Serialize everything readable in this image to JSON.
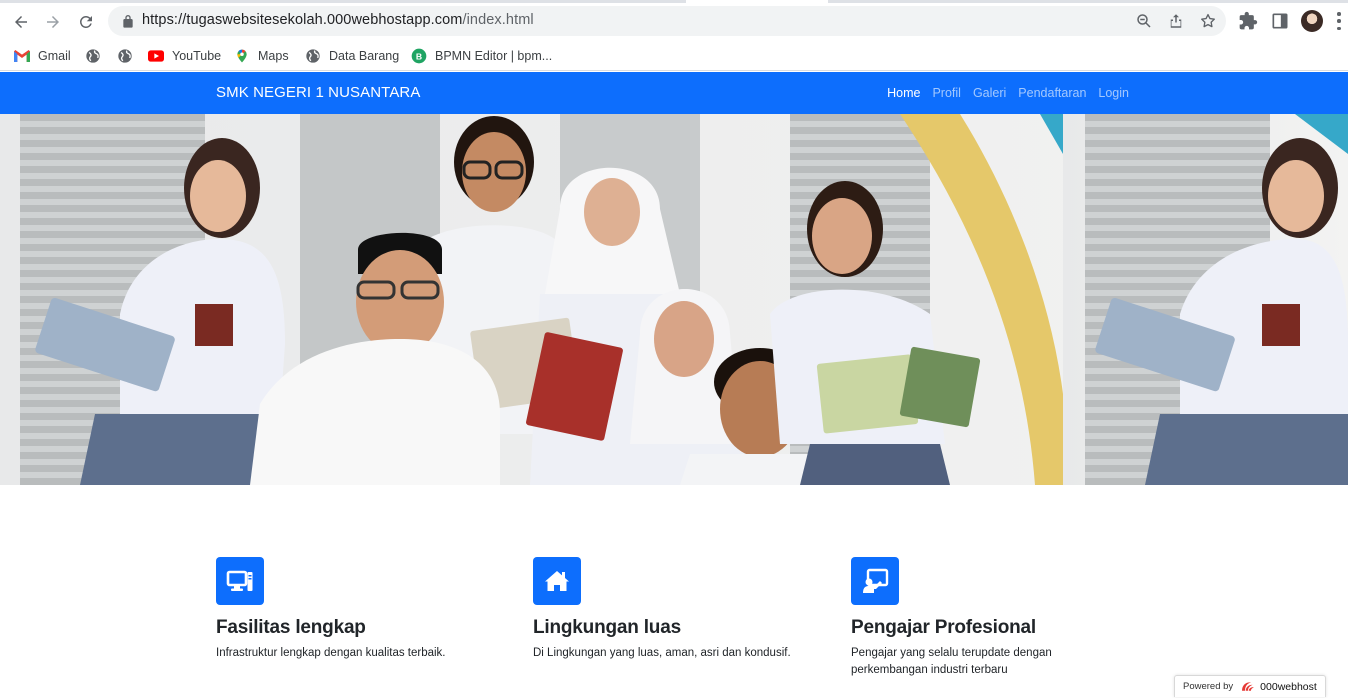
{
  "browser": {
    "url_main": "https://tugaswebsitesekolah.000webhostapp.com",
    "url_path": "/index.html",
    "bookmarks": [
      {
        "label": "Gmail",
        "icon": "gmail-icon"
      },
      {
        "label": "",
        "icon": "globe-icon"
      },
      {
        "label": "",
        "icon": "globe-icon"
      },
      {
        "label": "YouTube",
        "icon": "youtube-icon"
      },
      {
        "label": "Maps",
        "icon": "maps-icon"
      },
      {
        "label": "Data Barang",
        "icon": "globe-icon"
      },
      {
        "label": "BPMN Editor | bpm...",
        "icon": "bpmn-icon"
      }
    ]
  },
  "site": {
    "brand": "SMK NEGERI 1 NUSANTARA",
    "nav": [
      "Home",
      "Profil",
      "Galeri",
      "Pendaftaran",
      "Login"
    ],
    "active_nav": "Home",
    "accent": "#0d6efd"
  },
  "features": [
    {
      "icon": "computer-icon",
      "title": "Fasilitas lengkap",
      "text": "Infrastruktur lengkap dengan kualitas terbaik."
    },
    {
      "icon": "house-icon",
      "title": "Lingkungan luas",
      "text": "Di Lingkungan yang luas, aman, asri dan kondusif."
    },
    {
      "icon": "teacher-icon",
      "title": "Pengajar Profesional",
      "text": "Pengajar yang selalu terupdate dengan perkembangan industri terbaru"
    }
  ],
  "badge": {
    "powered": "Powered by",
    "host": "000webhost"
  }
}
